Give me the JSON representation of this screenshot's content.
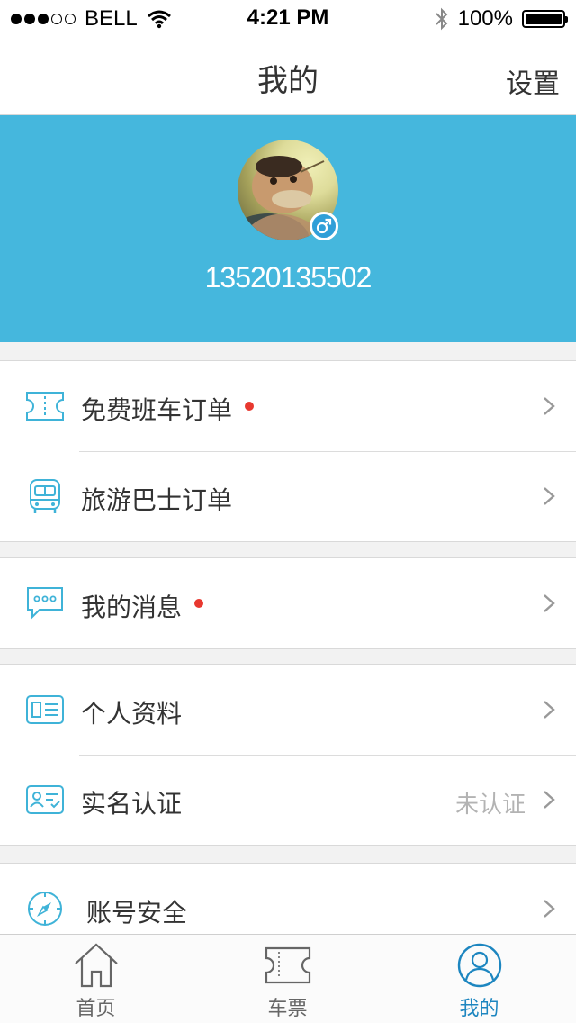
{
  "status_bar": {
    "carrier": "BELL",
    "time": "4:21 PM",
    "battery": "100%"
  },
  "nav": {
    "title": "我的",
    "action_label": "设置"
  },
  "profile": {
    "phone": "13520135502",
    "gender": "male"
  },
  "menu": {
    "free_shuttle_orders": {
      "label": "免费班车订单",
      "has_notification": true
    },
    "tour_bus_orders": {
      "label": "旅游巴士订单"
    },
    "my_messages": {
      "label": "我的消息",
      "has_notification": true
    },
    "personal_info": {
      "label": "个人资料"
    },
    "real_name_auth": {
      "label": "实名认证",
      "status": "未认证"
    },
    "account_security": {
      "label": "账号安全"
    }
  },
  "tabs": [
    {
      "label": "首页",
      "icon": "home-icon",
      "active": false
    },
    {
      "label": "车票",
      "icon": "ticket-icon",
      "active": false
    },
    {
      "label": "我的",
      "icon": "profile-icon",
      "active": true
    }
  ],
  "colors": {
    "header_bg": "#45b7dd",
    "icon_accent": "#3fb3d8",
    "notification_dot": "#e8382f",
    "active_tab": "#1d86c0"
  }
}
